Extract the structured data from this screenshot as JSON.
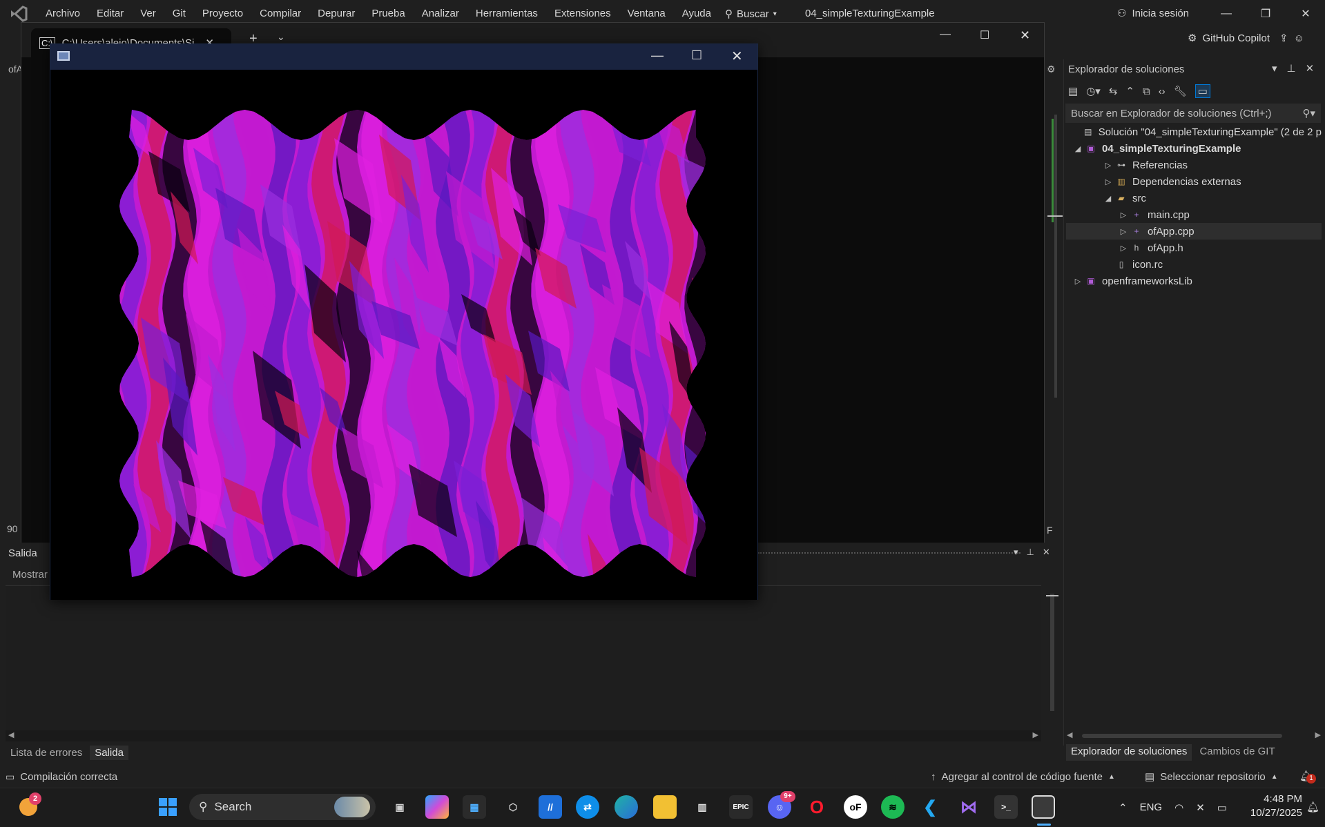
{
  "menubar": {
    "items": [
      "Archivo",
      "Editar",
      "Ver",
      "Git",
      "Proyecto",
      "Compilar",
      "Depurar",
      "Prueba",
      "Analizar",
      "Herramientas",
      "Extensiones",
      "Ventana",
      "Ayuda"
    ],
    "search_label": "Buscar",
    "solution_title": "04_simpleTexturingExample",
    "signin_label": "Inicia sesión",
    "copilot_label": "GitHub Copilot"
  },
  "terminal": {
    "tab_title": "C:\\Users\\alejo\\Documents\\Si",
    "new_tab": "+",
    "tab_menu": "⌄"
  },
  "editor": {
    "left_fragment": "ofA",
    "line_number": "90",
    "right_fragment": "F"
  },
  "output": {
    "title": "Salida",
    "show_label": "Mostrar"
  },
  "bottom_tabs": [
    "Lista de errores",
    "Salida"
  ],
  "solution_explorer": {
    "title": "Explorador de soluciones",
    "search_placeholder": "Buscar en Explorador de soluciones (Ctrl+;)",
    "tree": [
      {
        "label": "Solución \"04_simpleTexturingExample\"  (2 de 2 p",
        "icon": "solution-icon",
        "caret": ""
      },
      {
        "label": "04_simpleTexturingExample",
        "icon": "project-icon",
        "caret": "◢"
      },
      {
        "label": "Referencias",
        "icon": "references-icon",
        "caret": "▷"
      },
      {
        "label": "Dependencias externas",
        "icon": "external-deps-icon",
        "caret": "▷"
      },
      {
        "label": "src",
        "icon": "folder-icon",
        "caret": "◢"
      },
      {
        "label": "main.cpp",
        "icon": "cpp-file-icon",
        "caret": "▷"
      },
      {
        "label": "ofApp.cpp",
        "icon": "cpp-file-icon",
        "caret": "▷"
      },
      {
        "label": "ofApp.h",
        "icon": "header-file-icon",
        "caret": "▷"
      },
      {
        "label": "icon.rc",
        "icon": "resource-file-icon",
        "caret": ""
      },
      {
        "label": "openframeworksLib",
        "icon": "project-icon",
        "caret": "▷"
      }
    ],
    "tabs": [
      "Explorador de soluciones",
      "Cambios de GIT"
    ]
  },
  "statusbar": {
    "build_status": "Compilación correcta",
    "git_label": "Agregar al control de código fuente",
    "repo_label": "Seleccionar repositorio",
    "notification_count": "1"
  },
  "taskbar": {
    "search_label": "Search",
    "widget_badge": "2",
    "discord_badge": "9+",
    "language": "ENG",
    "time": "4:48 PM",
    "date": "10/27/2025"
  },
  "colors": {
    "accent": "#0078d4",
    "bg": "#1f1f1f",
    "vs_purple": "#8b5cf6",
    "app_title": "#19233f",
    "wave_palette": [
      "#7a1fd6",
      "#c21ad0",
      "#e020e0",
      "#d21a55",
      "#5a18c0",
      "#9b2fe0",
      "#0a0010"
    ]
  }
}
